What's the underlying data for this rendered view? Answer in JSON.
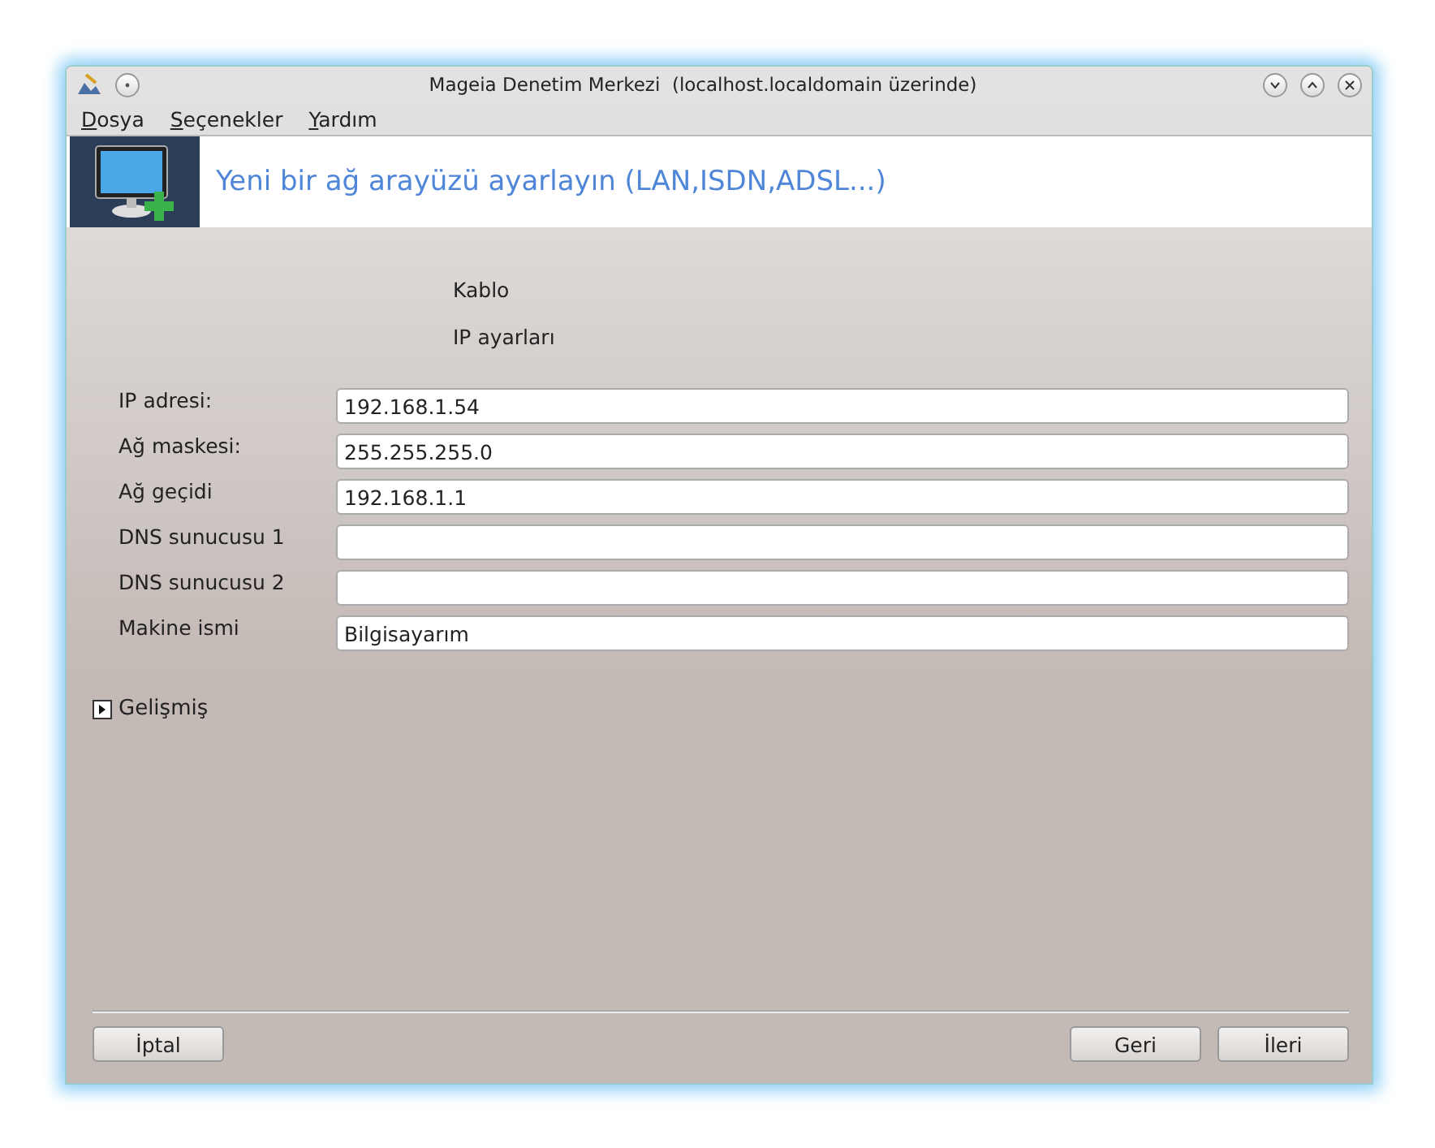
{
  "window": {
    "title": "Mageia Denetim Merkezi  (localhost.localdomain üzerinde)"
  },
  "menu": [
    {
      "label": "Dosya"
    },
    {
      "label": "Seçenekler"
    },
    {
      "label": "Yardım"
    }
  ],
  "header": {
    "title": "Yeni bir ağ arayüzü ayarlayın (LAN,ISDN,ADSL...)"
  },
  "connection_type": "Kablo",
  "section_title": "IP ayarları",
  "fields": [
    {
      "label": "IP adresi:",
      "value": "192.168.1.54"
    },
    {
      "label": "Ağ maskesi:",
      "value": "255.255.255.0"
    },
    {
      "label": "Ağ geçidi",
      "value": "192.168.1.1"
    },
    {
      "label": "DNS sunucusu 1"
    },
    {
      "label": "DNS sunucusu 2"
    },
    {
      "label": "Makine ismi",
      "value": "Bilgisayarım"
    }
  ],
  "advanced": {
    "label": "Gelişmiş",
    "expanded": false
  },
  "buttons_left": [
    "İptal"
  ],
  "buttons_right": [
    "Geri",
    "İleri"
  ]
}
